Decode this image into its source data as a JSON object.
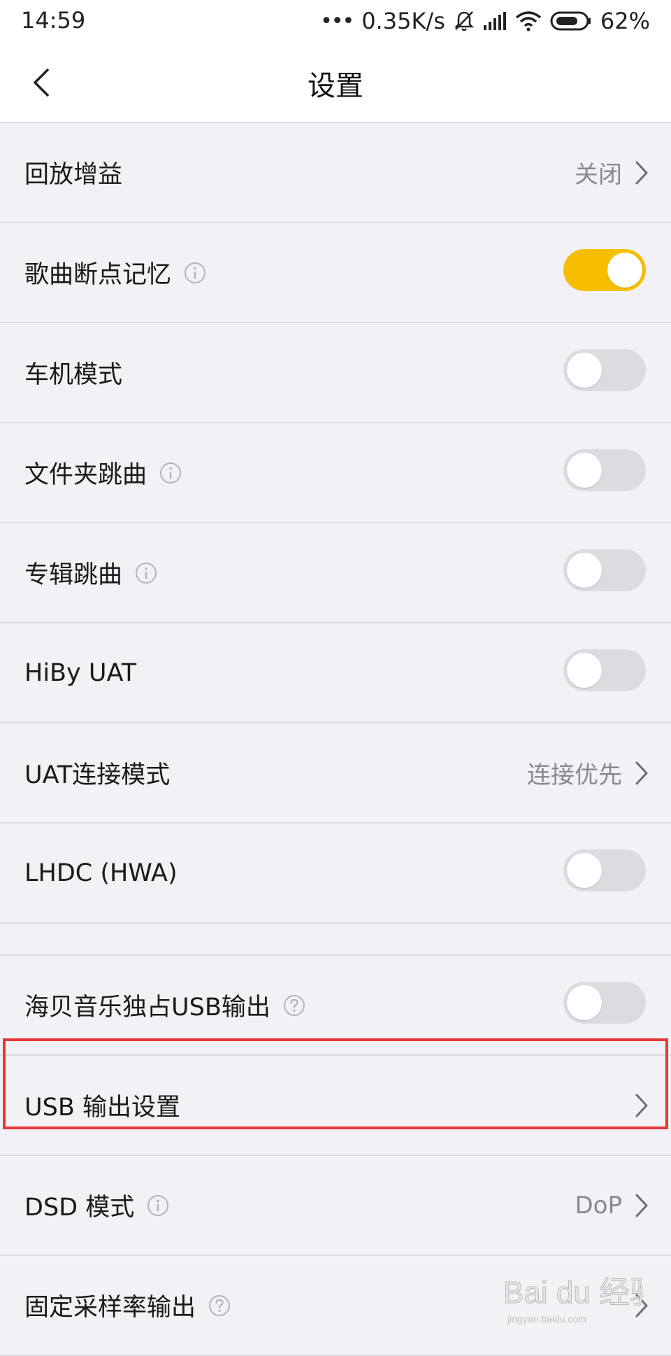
{
  "status_bar": {
    "time": "14:59",
    "network_speed": "0.35K/s",
    "battery": "62%",
    "icons": [
      "dots-icon",
      "bell-muted-icon",
      "signal-icon",
      "wifi-icon",
      "battery-icon"
    ]
  },
  "nav": {
    "title": "设置",
    "back_icon": "chevron-left-icon"
  },
  "rows": {
    "playback_gain": {
      "label": "回放增益",
      "value": "关闭"
    },
    "resume": {
      "label": "歌曲断点记忆",
      "on": true
    },
    "car_mode": {
      "label": "车机模式",
      "on": false
    },
    "folder_skip": {
      "label": "文件夹跳曲",
      "on": false
    },
    "album_skip": {
      "label": "专辑跳曲",
      "on": false
    },
    "hiby_uat": {
      "label": "HiBy UAT",
      "on": false
    },
    "uat_mode": {
      "label": "UAT连接模式",
      "value": "连接优先"
    },
    "lhdc": {
      "label": "LHDC (HWA)",
      "on": false
    },
    "usb_exclusive": {
      "label": "海贝音乐独占USB输出",
      "on": false
    },
    "usb_output": {
      "label": "USB 输出设置"
    },
    "dsd_mode": {
      "label": "DSD 模式",
      "value": "DoP"
    },
    "fixed_rate": {
      "label": "固定采样率输出"
    }
  },
  "colors": {
    "accent": "#f7be00",
    "highlight_box": "#e53935",
    "background": "#f2f1f6"
  },
  "watermark": {
    "text": "Bai du 经验",
    "sub": "jingyan.baidu.com"
  }
}
